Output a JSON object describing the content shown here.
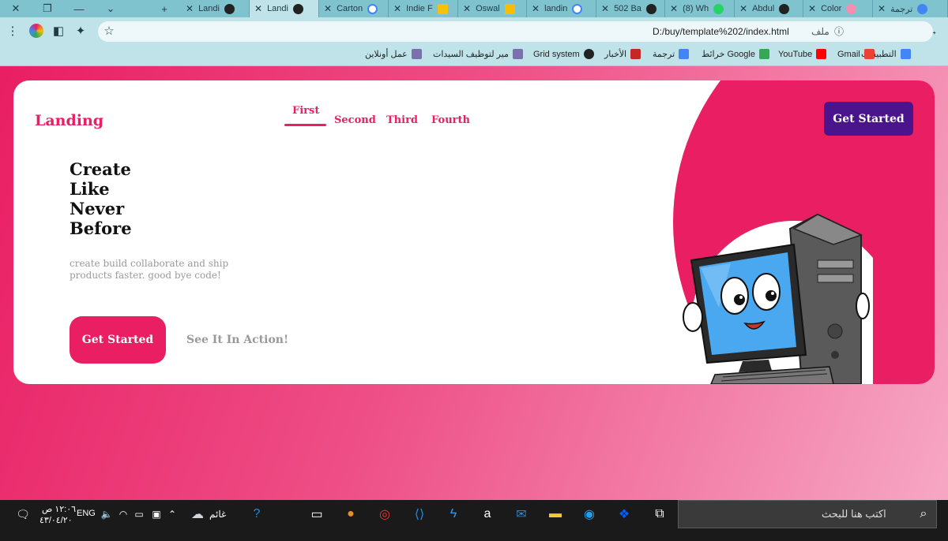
{
  "browser": {
    "tabs": [
      {
        "title": "ترجمة"
      },
      {
        "title": "Color"
      },
      {
        "title": "Abdul"
      },
      {
        "title": "(8) Wh"
      },
      {
        "title": "502 Ba"
      },
      {
        "title": "landin"
      },
      {
        "title": "Oswal"
      },
      {
        "title": "Indie F"
      },
      {
        "title": "Carton"
      },
      {
        "title": "Landi"
      },
      {
        "title": "Landi"
      }
    ],
    "new_tab": "+",
    "url": "D:/buy/template%202/index.html",
    "url_label": "ملف",
    "bookmarks": [
      {
        "label": "التطبيقات",
        "color": "#4285f4"
      },
      {
        "label": "Gmail",
        "color": "#ea4335"
      },
      {
        "label": "YouTube",
        "color": "#ff0000"
      },
      {
        "label": "خرائط Google",
        "color": "#34a853"
      },
      {
        "label": "ترجمة",
        "color": "#4285f4"
      },
      {
        "label": "الأخبار",
        "color": "#c62828"
      },
      {
        "label": "Grid system",
        "color": "#222222"
      },
      {
        "label": "مير لتوظيف السيدات",
        "color": "#7b6fb0"
      },
      {
        "label": "عمل أونلاين",
        "color": "#7b6fb0"
      }
    ]
  },
  "site": {
    "logo": "Landing",
    "nav": [
      "First",
      "Second",
      "Third",
      "Fourth"
    ],
    "active_nav": "First",
    "cta_top": "Get Started",
    "headline": [
      "Create",
      "Like",
      "Never",
      "Before"
    ],
    "subtitle": "create build collaborate and ship products faster. good bye code!",
    "cta_main": "Get Started",
    "cta_link": "See It In Action!",
    "colors": {
      "accent": "#e91e63",
      "purple": "#4a148c"
    }
  },
  "taskbar": {
    "search_placeholder": "اكتب هنا للبحث",
    "weather": "غائم",
    "language": "ENG",
    "time": "١٢:٠٦ ص",
    "date": "٤٣/٠٤/٢٠"
  }
}
